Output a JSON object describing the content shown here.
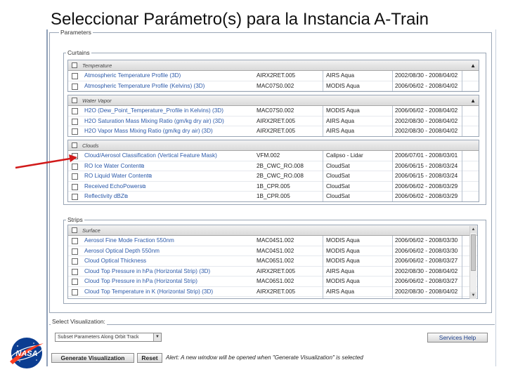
{
  "slide": {
    "title": "Seleccionar Parámetro(s) para la Instancia A-Train"
  },
  "parameters": {
    "legend": "Parameters",
    "curtains": {
      "legend": "Curtains",
      "groups": [
        {
          "label": "Temperature",
          "rows": [
            {
              "name": "Atmospheric Temperature Profile (3D)",
              "product": "AIRX2RET.005",
              "sensor": "AIRS Aqua",
              "dates": "2002/08/30 - 2008/04/02"
            },
            {
              "name": "Atmospheric Temperature Profile (Kelvins) (3D)",
              "product": "MAC07S0.002",
              "sensor": "MODIS Aqua",
              "dates": "2006/06/02 - 2008/04/02"
            }
          ]
        },
        {
          "label": "Water Vapor",
          "rows": [
            {
              "name": "H2O (Dew_Point_Temperature_Profile in Kelvins) (3D)",
              "product": "MAC07S0.002",
              "sensor": "MODIS Aqua",
              "dates": "2006/06/02 - 2008/04/02"
            },
            {
              "name": "H2O Saturation Mass Mixing Ratio (gm/kg dry air) (3D)",
              "product": "AIRX2RET.005",
              "sensor": "AIRS Aqua",
              "dates": "2002/08/30 - 2008/04/02"
            },
            {
              "name": "H2O Vapor Mass Mixing Ratio (gm/kg dry air) (3D)",
              "product": "AIRX2RET.005",
              "sensor": "AIRS Aqua",
              "dates": "2002/08/30 - 2008/04/02"
            }
          ]
        },
        {
          "label": "Clouds",
          "rows": [
            {
              "name": "Cloud/Aerosol Classification (Vertical Feature Mask)",
              "product": "VFM.002",
              "sensor": "Calipso - Lidar",
              "dates": "2006/07/01 - 2008/03/01",
              "link": false
            },
            {
              "name": "RO Ice Water Content",
              "product": "2B_CWC_RO.008",
              "sensor": "CloudSat",
              "dates": "2006/06/15 - 2008/03/24",
              "link": true
            },
            {
              "name": "RO Liquid Water Content",
              "product": "2B_CWC_RO.008",
              "sensor": "CloudSat",
              "dates": "2006/06/15 - 2008/03/24",
              "link": true
            },
            {
              "name": "Received EchoPowers",
              "product": "1B_CPR.005",
              "sensor": "CloudSat",
              "dates": "2006/06/02 - 2008/03/29",
              "link": true
            },
            {
              "name": "Reflectivity dBZ",
              "product": "1B_CPR.005",
              "sensor": "CloudSat",
              "dates": "2006/06/02 - 2008/03/29",
              "link": true
            }
          ]
        }
      ]
    },
    "strips": {
      "legend": "Strips",
      "groups": [
        {
          "label": "Surface",
          "rows": [
            {
              "name": "Aerosol Fine Mode Fraction 550nm",
              "product": "MAC04S1.002",
              "sensor": "MODIS Aqua",
              "dates": "2006/06/02 - 2008/03/30"
            },
            {
              "name": "Aerosol Optical Depth 550nm",
              "product": "MAC04S1.002",
              "sensor": "MODIS Aqua",
              "dates": "2006/06/02 - 2008/03/30"
            },
            {
              "name": "Cloud Optical Thickness",
              "product": "MAC06S1.002",
              "sensor": "MODIS Aqua",
              "dates": "2006/06/02 - 2008/03/27"
            },
            {
              "name": "Cloud Top Pressure in hPa (Horizontal Strip) (3D)",
              "product": "AIRX2RET.005",
              "sensor": "AIRS Aqua",
              "dates": "2002/08/30 - 2008/04/02"
            },
            {
              "name": "Cloud Top Pressure in hPa (Horizontal Strip)",
              "product": "MAC06S1.002",
              "sensor": "MODIS Aqua",
              "dates": "2006/06/02 - 2008/03/27"
            },
            {
              "name": "Cloud Top Temperature in K (Horizontal Strip) (3D)",
              "product": "AIRX2RET.005",
              "sensor": "AIRS Aqua",
              "dates": "2002/08/30 - 2008/04/02"
            }
          ]
        }
      ]
    }
  },
  "visualization": {
    "legend": "Select Visualization:",
    "selected": "Subset Parameters Along Orbit Track",
    "services_help": "Services   Help",
    "generate_label": "Generate Visualization",
    "reset_label": "Reset",
    "alert": "Alert: A new window will be opened when \"Generate Visualization\" is selected"
  },
  "logo": {
    "text": "NASA"
  },
  "colors": {
    "link": "#2a58a8",
    "pointer_arrow": "#d11a1a",
    "nasa_blue": "#0b3d91",
    "nasa_red": "#fc3d21"
  }
}
